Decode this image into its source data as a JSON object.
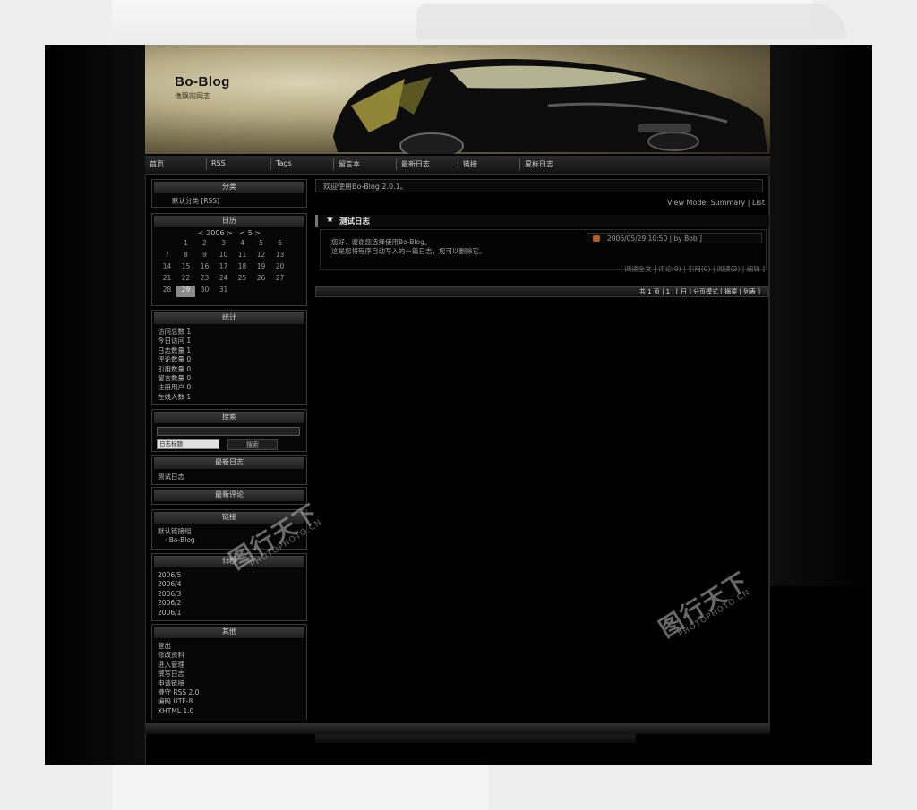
{
  "blog": {
    "title": "Bo-Blog",
    "slogan": "逸飘的网志"
  },
  "nav": {
    "items": [
      "首页",
      "RSS",
      "Tags",
      "留言本",
      "最新日志",
      "链接",
      "星标日志"
    ]
  },
  "sidebar": {
    "category": {
      "title": "分类",
      "items": [
        "默认分类 [RSS]"
      ]
    },
    "calendar": {
      "title": "日历",
      "year_nav": "< 2006 >",
      "month_nav": "< 5 >",
      "days": [
        "",
        "1",
        "2",
        "3",
        "4",
        "5",
        "6",
        "7",
        "8",
        "9",
        "10",
        "11",
        "12",
        "13",
        "14",
        "15",
        "16",
        "17",
        "18",
        "19",
        "20",
        "21",
        "22",
        "23",
        "24",
        "25",
        "26",
        "27",
        "28",
        "29",
        "30",
        "31",
        "",
        "",
        ""
      ],
      "today": "29"
    },
    "stats": {
      "title": "统计",
      "items": [
        "访问总数 1",
        "今日访问 1",
        "日志数量 1",
        "评论数量 0",
        "引用数量 0",
        "留言数量 0",
        "注册用户 0",
        "在线人数 1"
      ]
    },
    "search": {
      "title": "搜索",
      "select_value": "日志标题",
      "button": "搜索"
    },
    "latest_posts": {
      "title": "最新日志",
      "items": [
        "测试日志"
      ]
    },
    "latest_comments": {
      "title": "最新评论"
    },
    "links": {
      "title": "链接",
      "group": "默认链接组",
      "items": [
        "Bo-Blog"
      ]
    },
    "archives": {
      "title": "归档",
      "items": [
        "2006/5",
        "2006/4",
        "2006/3",
        "2006/2",
        "2006/1"
      ]
    },
    "other": {
      "title": "其他",
      "items": [
        "登出",
        "修改资料",
        "进入管理",
        "撰写日志",
        "申请链接",
        "遵守 RSS 2.0",
        "编码 UTF-8",
        "XHTML 1.0"
      ]
    }
  },
  "main": {
    "notice": "欢迎使用Bo-Blog 2.0.1。",
    "view_mode": "View Mode: Summary | List",
    "post": {
      "title": "测试日志",
      "lines": [
        "您好，谢谢您选择使用Bo-Blog。",
        "这是您将程序自动写入的一篇日志，您可以删除它。"
      ],
      "date": "2006/05/29 10:50 | by Bob ]",
      "footer": "[ 阅读全文 | 评论(0) | 引用(0) | 阅读(2) | 编辑 ]"
    },
    "pager": "共 1 页 | 1 | [ 日 ] 分页模式 [ 摘要 | 列表 ]"
  },
  "watermark": {
    "text": "图行天下",
    "sub": "PHOTOPHOTO.CN"
  },
  "colors": {
    "background": "#000000",
    "outer": "#eeeeee",
    "text": "#b9b9b9",
    "accent": "#b25a2a"
  }
}
